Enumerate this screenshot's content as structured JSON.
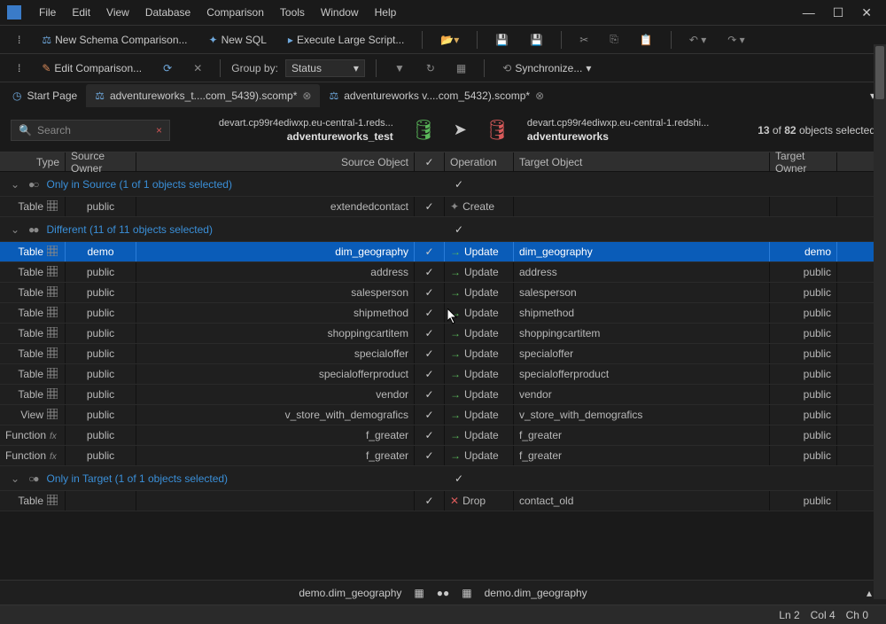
{
  "menu": [
    "File",
    "Edit",
    "View",
    "Database",
    "Comparison",
    "Tools",
    "Window",
    "Help"
  ],
  "toolbar1": {
    "new_schema": "New Schema Comparison...",
    "new_sql": "New SQL",
    "execute": "Execute Large Script..."
  },
  "toolbar2": {
    "edit_comp": "Edit Comparison...",
    "group_by_label": "Group by:",
    "group_by_value": "Status",
    "sync": "Synchronize..."
  },
  "tabs": [
    {
      "label": "Start Page",
      "icon": "clock"
    },
    {
      "label": "adventureworks_t....com_5439).scomp*",
      "icon": "compare",
      "active": true,
      "closable": true
    },
    {
      "label": "adventureworks v....com_5432).scomp*",
      "icon": "compare",
      "closable": true
    }
  ],
  "search": {
    "placeholder": "Search"
  },
  "source": {
    "conn": "devart.cp99r4ediwxp.eu-central-1.reds...",
    "name": "adventureworks_test"
  },
  "target": {
    "conn": "devart.cp99r4ediwxp.eu-central-1.redshi...",
    "name": "adventureworks"
  },
  "selection": {
    "count": "13",
    "total": "82",
    "label": "objects selected"
  },
  "columns": {
    "type": "Type",
    "source_owner": "Source Owner",
    "source_object": "Source Object",
    "operation": "Operation",
    "target_object": "Target Object",
    "target_owner": "Target Owner"
  },
  "groups": [
    {
      "label": "Only in Source (1 of 1 objects selected)",
      "dots": "●○",
      "rows": [
        {
          "type": "Table",
          "owner": "public",
          "source": "extendedcontact",
          "checked": true,
          "op_icon": "star",
          "op": "Create",
          "target": "",
          "towner": ""
        }
      ]
    },
    {
      "label": "Different (11 of 11 objects selected)",
      "dots": "●●",
      "rows": [
        {
          "type": "Table",
          "owner": "demo",
          "source": "dim_geography",
          "checked": true,
          "op_icon": "arrow",
          "op": "Update",
          "target": "dim_geography",
          "towner": "demo",
          "selected": true
        },
        {
          "type": "Table",
          "owner": "public",
          "source": "address",
          "checked": true,
          "op_icon": "arrow",
          "op": "Update",
          "target": "address",
          "towner": "public"
        },
        {
          "type": "Table",
          "owner": "public",
          "source": "salesperson",
          "checked": true,
          "op_icon": "arrow",
          "op": "Update",
          "target": "salesperson",
          "towner": "public"
        },
        {
          "type": "Table",
          "owner": "public",
          "source": "shipmethod",
          "checked": true,
          "op_icon": "arrow",
          "op": "Update",
          "target": "shipmethod",
          "towner": "public"
        },
        {
          "type": "Table",
          "owner": "public",
          "source": "shoppingcartitem",
          "checked": true,
          "op_icon": "arrow",
          "op": "Update",
          "target": "shoppingcartitem",
          "towner": "public"
        },
        {
          "type": "Table",
          "owner": "public",
          "source": "specialoffer",
          "checked": true,
          "op_icon": "arrow",
          "op": "Update",
          "target": "specialoffer",
          "towner": "public"
        },
        {
          "type": "Table",
          "owner": "public",
          "source": "specialofferproduct",
          "checked": true,
          "op_icon": "arrow",
          "op": "Update",
          "target": "specialofferproduct",
          "towner": "public"
        },
        {
          "type": "Table",
          "owner": "public",
          "source": "vendor",
          "checked": true,
          "op_icon": "arrow",
          "op": "Update",
          "target": "vendor",
          "towner": "public"
        },
        {
          "type": "View",
          "owner": "public",
          "source": "v_store_with_demografics",
          "checked": true,
          "op_icon": "arrow",
          "op": "Update",
          "target": "v_store_with_demografics",
          "towner": "public"
        },
        {
          "type": "Function",
          "type_icon": "fx",
          "owner": "public",
          "source": "f_greater",
          "checked": true,
          "op_icon": "arrow",
          "op": "Update",
          "target": "f_greater",
          "towner": "public"
        },
        {
          "type": "Function",
          "type_icon": "fx",
          "owner": "public",
          "source": "f_greater",
          "checked": true,
          "op_icon": "arrow",
          "op": "Update",
          "target": "f_greater",
          "towner": "public"
        }
      ]
    },
    {
      "label": "Only in Target (1 of 1 objects selected)",
      "dots": "○●",
      "rows": [
        {
          "type": "Table",
          "owner": "",
          "source": "",
          "checked": true,
          "op_icon": "x",
          "op": "Drop",
          "target": "contact_old",
          "towner": "public"
        }
      ]
    }
  ],
  "footer": {
    "left": "demo.dim_geography",
    "right": "demo.dim_geography"
  },
  "status": {
    "ln": "Ln 2",
    "col": "Col 4",
    "ch": "Ch 0"
  }
}
